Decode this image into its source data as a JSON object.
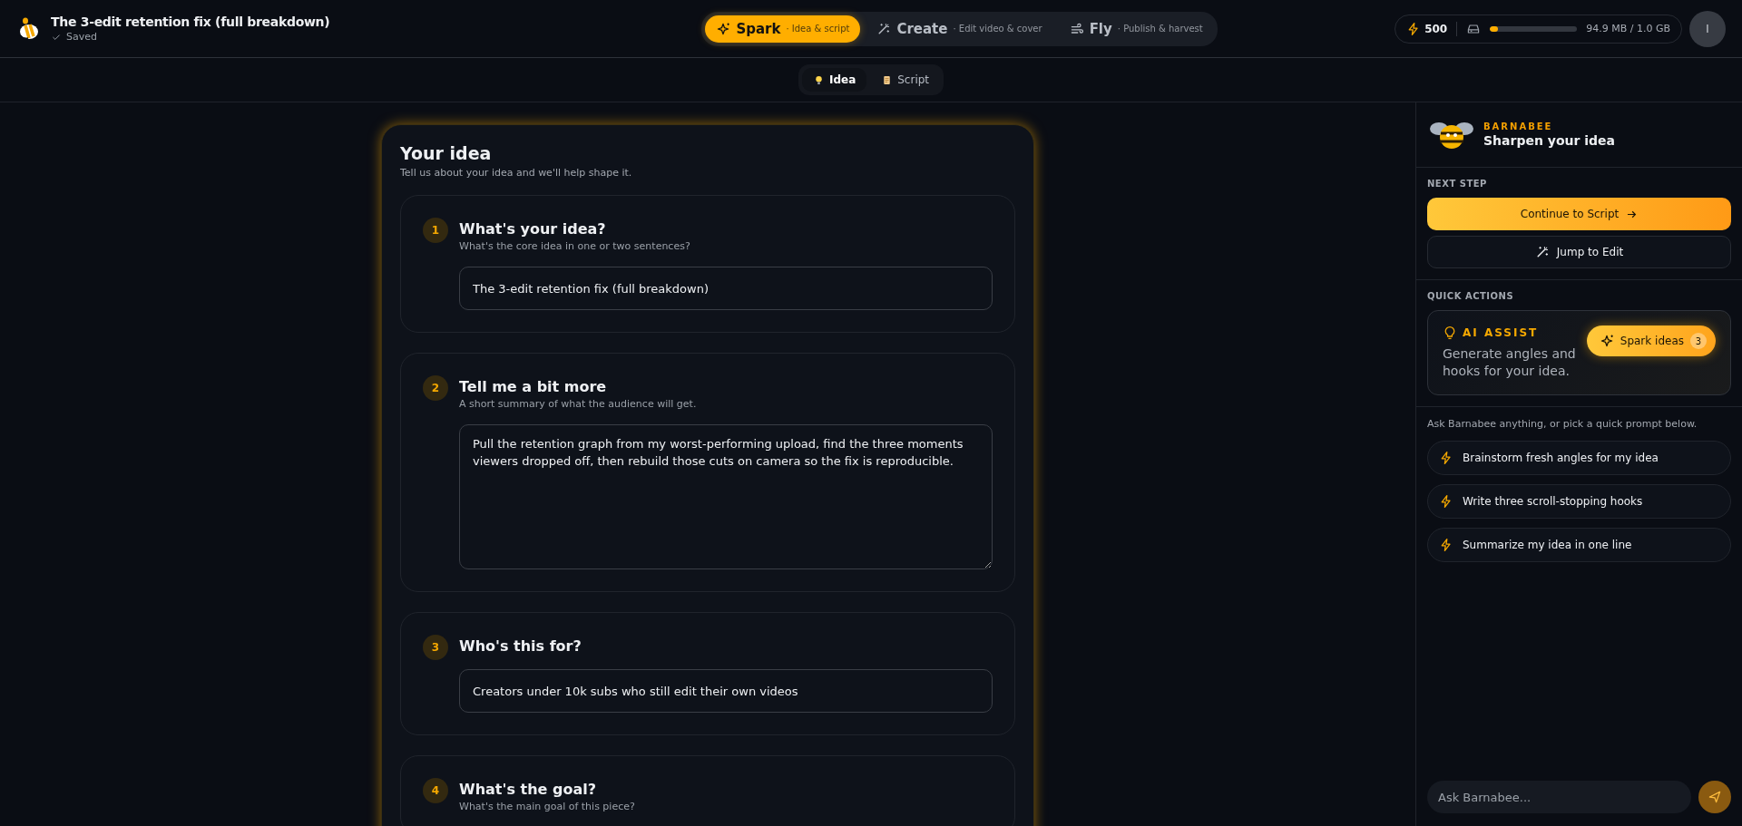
{
  "header": {
    "title": "The 3-edit retention fix (full breakdown)",
    "save_status": "Saved"
  },
  "stages": [
    {
      "label": "Spark",
      "caption": "· Idea & script",
      "selected": true
    },
    {
      "label": "Create",
      "caption": "· Edit video & cover",
      "selected": false
    },
    {
      "label": "Fly",
      "caption": "· Publish & harvest",
      "selected": false
    }
  ],
  "credits": "500",
  "storage": {
    "level": 0.095,
    "reading": "94.9 MB / 1.0 GB"
  },
  "avatar": "I",
  "subtabs": [
    {
      "label": "Idea",
      "selected": true
    },
    {
      "label": "Script",
      "selected": false
    }
  ],
  "card": {
    "title": "Your idea",
    "subtitle": "Tell us about your idea and we'll help shape it.",
    "sections": [
      {
        "number": "1",
        "title": "What's your idea?",
        "subtitle": "What's the core idea in one or two sentences?",
        "field": {
          "kind": "input",
          "value": "The 3-edit retention fix (full breakdown)"
        }
      },
      {
        "number": "2",
        "title": "Tell me a bit more",
        "subtitle": "A short summary of what the audience will get.",
        "field": {
          "kind": "textarea",
          "value": "Pull the retention graph from my worst-performing upload, find the three moments viewers dropped off, then rebuild those cuts on camera so the fix is reproducible."
        }
      },
      {
        "number": "3",
        "title": "Who's this for?",
        "field": {
          "kind": "input",
          "value": "Creators under 10k subs who still edit their own videos"
        }
      },
      {
        "number": "4",
        "title": "What's the goal?",
        "subtitle": "What's the main goal of this piece?"
      }
    ]
  },
  "assistant": {
    "name": "BARNABEE",
    "heading": "Sharpen your idea",
    "next_step_label": "NEXT STEP",
    "primary_action": "Continue to Script",
    "secondary_action": "Jump to Edit",
    "quick_actions_label": "QUICK ACTIONS",
    "assist": {
      "label": "AI ASSIST",
      "text": "Generate angles and hooks for your idea.",
      "button": "Spark ideas",
      "count": "3"
    },
    "intro": "Ask Barnabee anything, or pick a quick prompt below.",
    "prompts": [
      "Brainstorm fresh angles for my idea",
      "Write three scroll-stopping hooks",
      "Summarize my idea in one line"
    ],
    "chat_placeholder": "Ask Barnabee..."
  }
}
